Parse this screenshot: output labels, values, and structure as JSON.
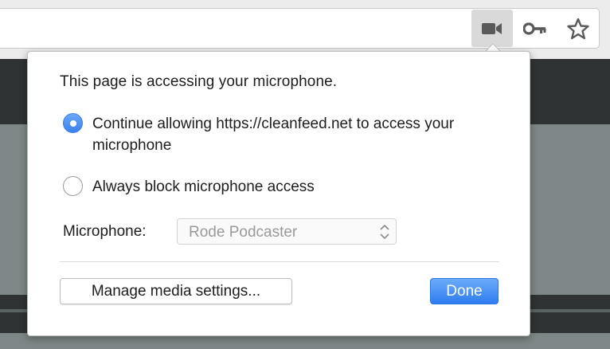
{
  "toolbar": {
    "icons": [
      "camera-icon",
      "key-icon",
      "star-icon"
    ]
  },
  "popup": {
    "title": "This page is accessing your microphone.",
    "options": [
      {
        "label": "Continue allowing https://cleanfeed.net to access your microphone",
        "selected": true
      },
      {
        "label": "Always block microphone access",
        "selected": false
      }
    ],
    "microphone_label": "Microphone:",
    "microphone_value": "Rode Podcaster",
    "manage_button": "Manage media settings...",
    "done_button": "Done"
  },
  "colors": {
    "accent": "#3a80ee",
    "page_dark": "#2f3333",
    "page_grey": "#7e8787"
  }
}
